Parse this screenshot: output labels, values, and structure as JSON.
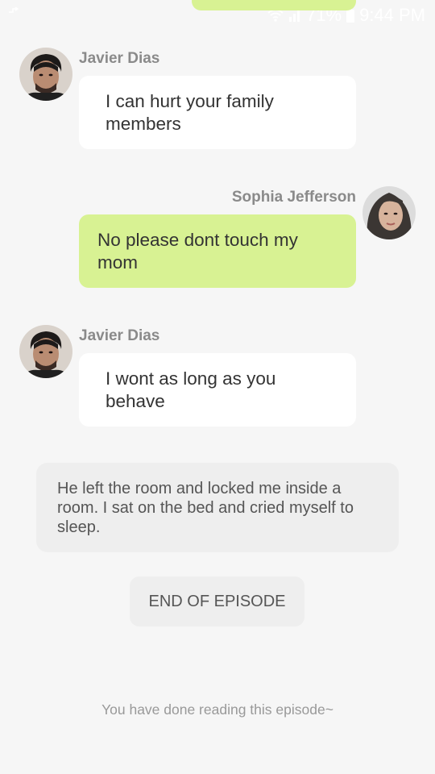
{
  "status_bar": {
    "signal_icon": "signal-icon",
    "wifi_icon": "wifi-icon",
    "battery_percent": "71%",
    "battery_icon": "battery-icon",
    "time": "9:44 PM"
  },
  "messages": [
    {
      "sender": "Javier Dias",
      "side": "left",
      "text": "I can hurt your family members",
      "avatar_icon": "male-avatar"
    },
    {
      "sender": "Sophia Jefferson",
      "side": "right",
      "text": "No please dont touch my mom",
      "avatar_icon": "female-avatar"
    },
    {
      "sender": "Javier Dias",
      "side": "left",
      "text": "I wont as long as you behave",
      "avatar_icon": "male-avatar"
    }
  ],
  "narration": {
    "text": "He left the room and locked me inside a room. I sat on the bed and cried myself to sleep."
  },
  "end_button": {
    "label": "END OF EPISODE"
  },
  "footer": {
    "text": "You have done reading this episode~"
  },
  "colors": {
    "background": "#f6f6f6",
    "outgoing_bubble": "#d8f293",
    "incoming_bubble": "#ffffff",
    "narration_bg": "#eeeeee"
  }
}
